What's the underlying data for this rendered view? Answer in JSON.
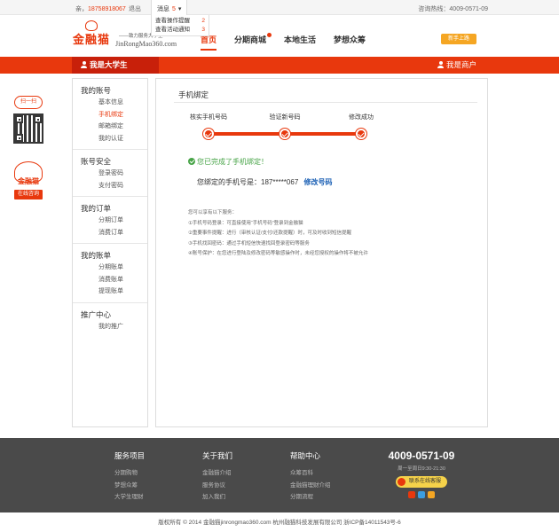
{
  "topbar": {
    "greeting_prefix": "亲，",
    "phone": "18758918067",
    "logout": "退出",
    "messages_label": "消息",
    "messages_count": "5",
    "hotline": "咨询热线：4009-0571-09"
  },
  "message_dropdown": [
    {
      "label": "查看操作提醒",
      "count": "2"
    },
    {
      "label": "查看活动通知",
      "count": "3"
    }
  ],
  "header": {
    "logo_text": "金融猫",
    "slogan": "——致力服务大学生",
    "domain": "JinRongMao360.com",
    "nav": [
      "首页",
      "分期商城",
      "本地生活",
      "梦想众筹"
    ],
    "newbie_badge": "新手上路"
  },
  "rolebar": {
    "student": "我是大学生",
    "merchant": "我是商户"
  },
  "qr_float": {
    "scan_label": "扫一扫",
    "mascot_label": "金融猫",
    "consult_label": "在线咨询"
  },
  "sidebar": [
    {
      "title": "我的账号",
      "items": [
        "基本信息",
        "手机绑定",
        "邮箱绑定",
        "我的认证"
      ],
      "active": "手机绑定"
    },
    {
      "title": "账号安全",
      "items": [
        "登录密码",
        "支付密码"
      ]
    },
    {
      "title": "我的订单",
      "items": [
        "分期订单",
        "消费订单"
      ]
    },
    {
      "title": "我的账单",
      "items": [
        "分期账单",
        "消费账单",
        "提现账单"
      ]
    },
    {
      "title": "推广中心",
      "items": [
        "我的推广"
      ]
    }
  ],
  "main": {
    "title": "手机绑定",
    "steps": [
      "核实手机号码",
      "验证新号码",
      "修改成功"
    ],
    "success_text": "您已完成了手机绑定！",
    "bound_label": "您绑定的手机号是：",
    "bound_number": "187*****067",
    "change_link": "修改号码",
    "tips": [
      "您可以享有以下服务：",
      "①手机号码登录：可直接使用“手机号码”登录到金融猫",
      "②重要事件提醒：进行（审核认证/支付/还款提醒）时，可及时收到短信提醒",
      "③手机找回密码：通过手机短信快速找回登录密码等服务",
      "④账号保护：在您进行登陆及修改密码等敏感操作时，未经您授权的操作将不被允许"
    ]
  },
  "footer": {
    "columns": [
      {
        "heading": "服务项目",
        "links": [
          "分期购物",
          "梦想众筹",
          "大学生理财"
        ]
      },
      {
        "heading": "关于我们",
        "links": [
          "金融猫介绍",
          "服务协议",
          "加入我们"
        ]
      },
      {
        "heading": "帮助中心",
        "links": [
          "众筹百科",
          "金融猫理财介绍",
          "分期流程"
        ]
      }
    ],
    "hotline": "4009-0571-09",
    "hours": "周一至周日9:30-21:30",
    "service_button": "联系在线客服",
    "copyright": "版权所有 © 2014 金融猫jinrongmao360.com   杭州融猫科技发展有限公司   浙ICP备14011543号-6"
  },
  "colors": {
    "brand_red": "#e8380d",
    "dark_red": "#c8200a",
    "success_green": "#47a447",
    "link_blue": "#1a5fb4",
    "footer_bg": "#4a4a4a"
  }
}
